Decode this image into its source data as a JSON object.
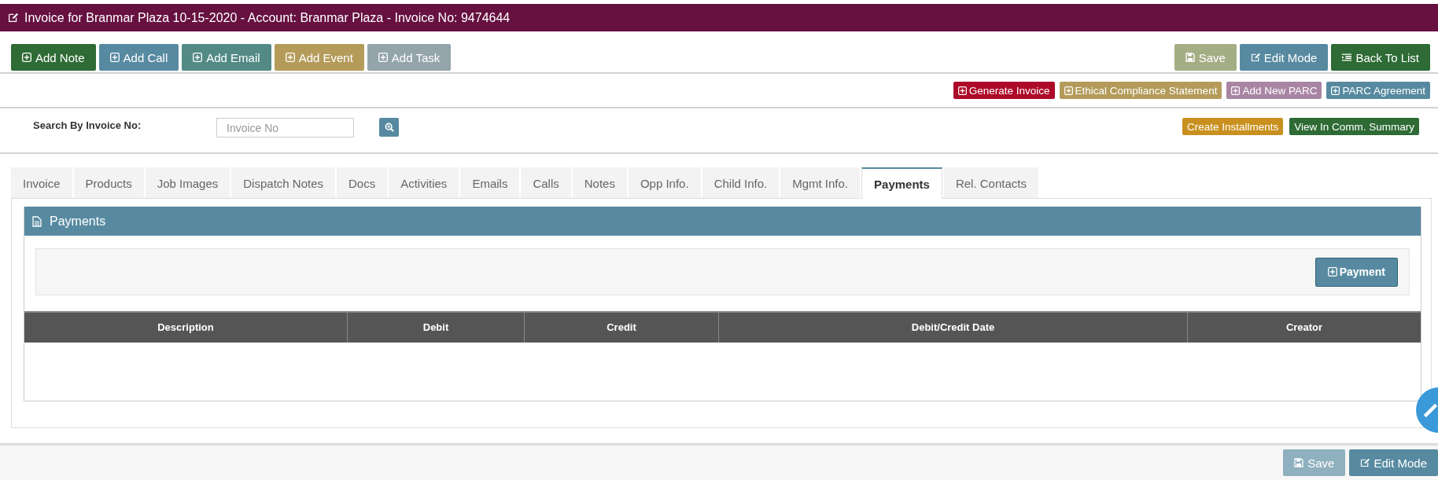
{
  "header": {
    "title": "Invoice for Branmar Plaza 10-15-2020 - Account: Branmar Plaza - Invoice No: 9474644"
  },
  "activity_buttons": [
    {
      "label": "Add Note",
      "kind": "plus",
      "color": "#2e6b35"
    },
    {
      "label": "Add Call",
      "kind": "plus",
      "color": "#578aa0"
    },
    {
      "label": "Add Email",
      "kind": "plus",
      "color": "#538a86"
    },
    {
      "label": "Add Event",
      "kind": "plus",
      "color": "#b49b5a"
    },
    {
      "label": "Add Task",
      "kind": "plus",
      "color": "#94a4ab"
    }
  ],
  "page_buttons": [
    {
      "label": "Save",
      "kind": "save",
      "color": "#a5ad85"
    },
    {
      "label": "Edit Mode",
      "kind": "edit",
      "color": "#578aa0"
    },
    {
      "label": "Back To List",
      "kind": "list",
      "color": "#2e6b35"
    }
  ],
  "invoice_actions": [
    {
      "label": "Generate Invoice",
      "kind": "plus",
      "color": "#ad0a2a"
    },
    {
      "label": "Ethical Compliance Statement",
      "kind": "plus",
      "color": "#b49b5a"
    },
    {
      "label": "Add New PARC",
      "kind": "plus",
      "color": "#a985a4"
    },
    {
      "label": "PARC Agreement",
      "kind": "plus",
      "color": "#578aa0"
    }
  ],
  "search": {
    "label": "Search By Invoice No:",
    "placeholder": "Invoice No"
  },
  "summary_buttons": [
    {
      "label": "Create Installments",
      "color": "#c9901f"
    },
    {
      "label": "View In Comm. Summary",
      "color": "#2e6b35"
    }
  ],
  "tabs": [
    {
      "label": "Invoice",
      "selected": false
    },
    {
      "label": "Products",
      "selected": false
    },
    {
      "label": "Job Images",
      "selected": false
    },
    {
      "label": "Dispatch Notes",
      "selected": false
    },
    {
      "label": "Docs",
      "selected": false
    },
    {
      "label": "Activities",
      "selected": false
    },
    {
      "label": "Emails",
      "selected": false
    },
    {
      "label": "Calls",
      "selected": false
    },
    {
      "label": "Notes",
      "selected": false
    },
    {
      "label": "Opp Info.",
      "selected": false
    },
    {
      "label": "Child Info.",
      "selected": false
    },
    {
      "label": "Mgmt Info.",
      "selected": false
    },
    {
      "label": "Payments",
      "selected": true
    },
    {
      "label": "Rel. Contacts",
      "selected": false
    }
  ],
  "payments_panel": {
    "title": "Payments",
    "add_button": "Payment",
    "table": {
      "columns": [
        "Description",
        "Debit",
        "Credit",
        "Debit/Credit Date",
        "Creator"
      ]
    }
  },
  "footer_buttons": [
    {
      "label": "Save",
      "kind": "save",
      "color": "#8fb0be"
    },
    {
      "label": "Edit Mode",
      "kind": "edit",
      "color": "#578aa0"
    }
  ]
}
